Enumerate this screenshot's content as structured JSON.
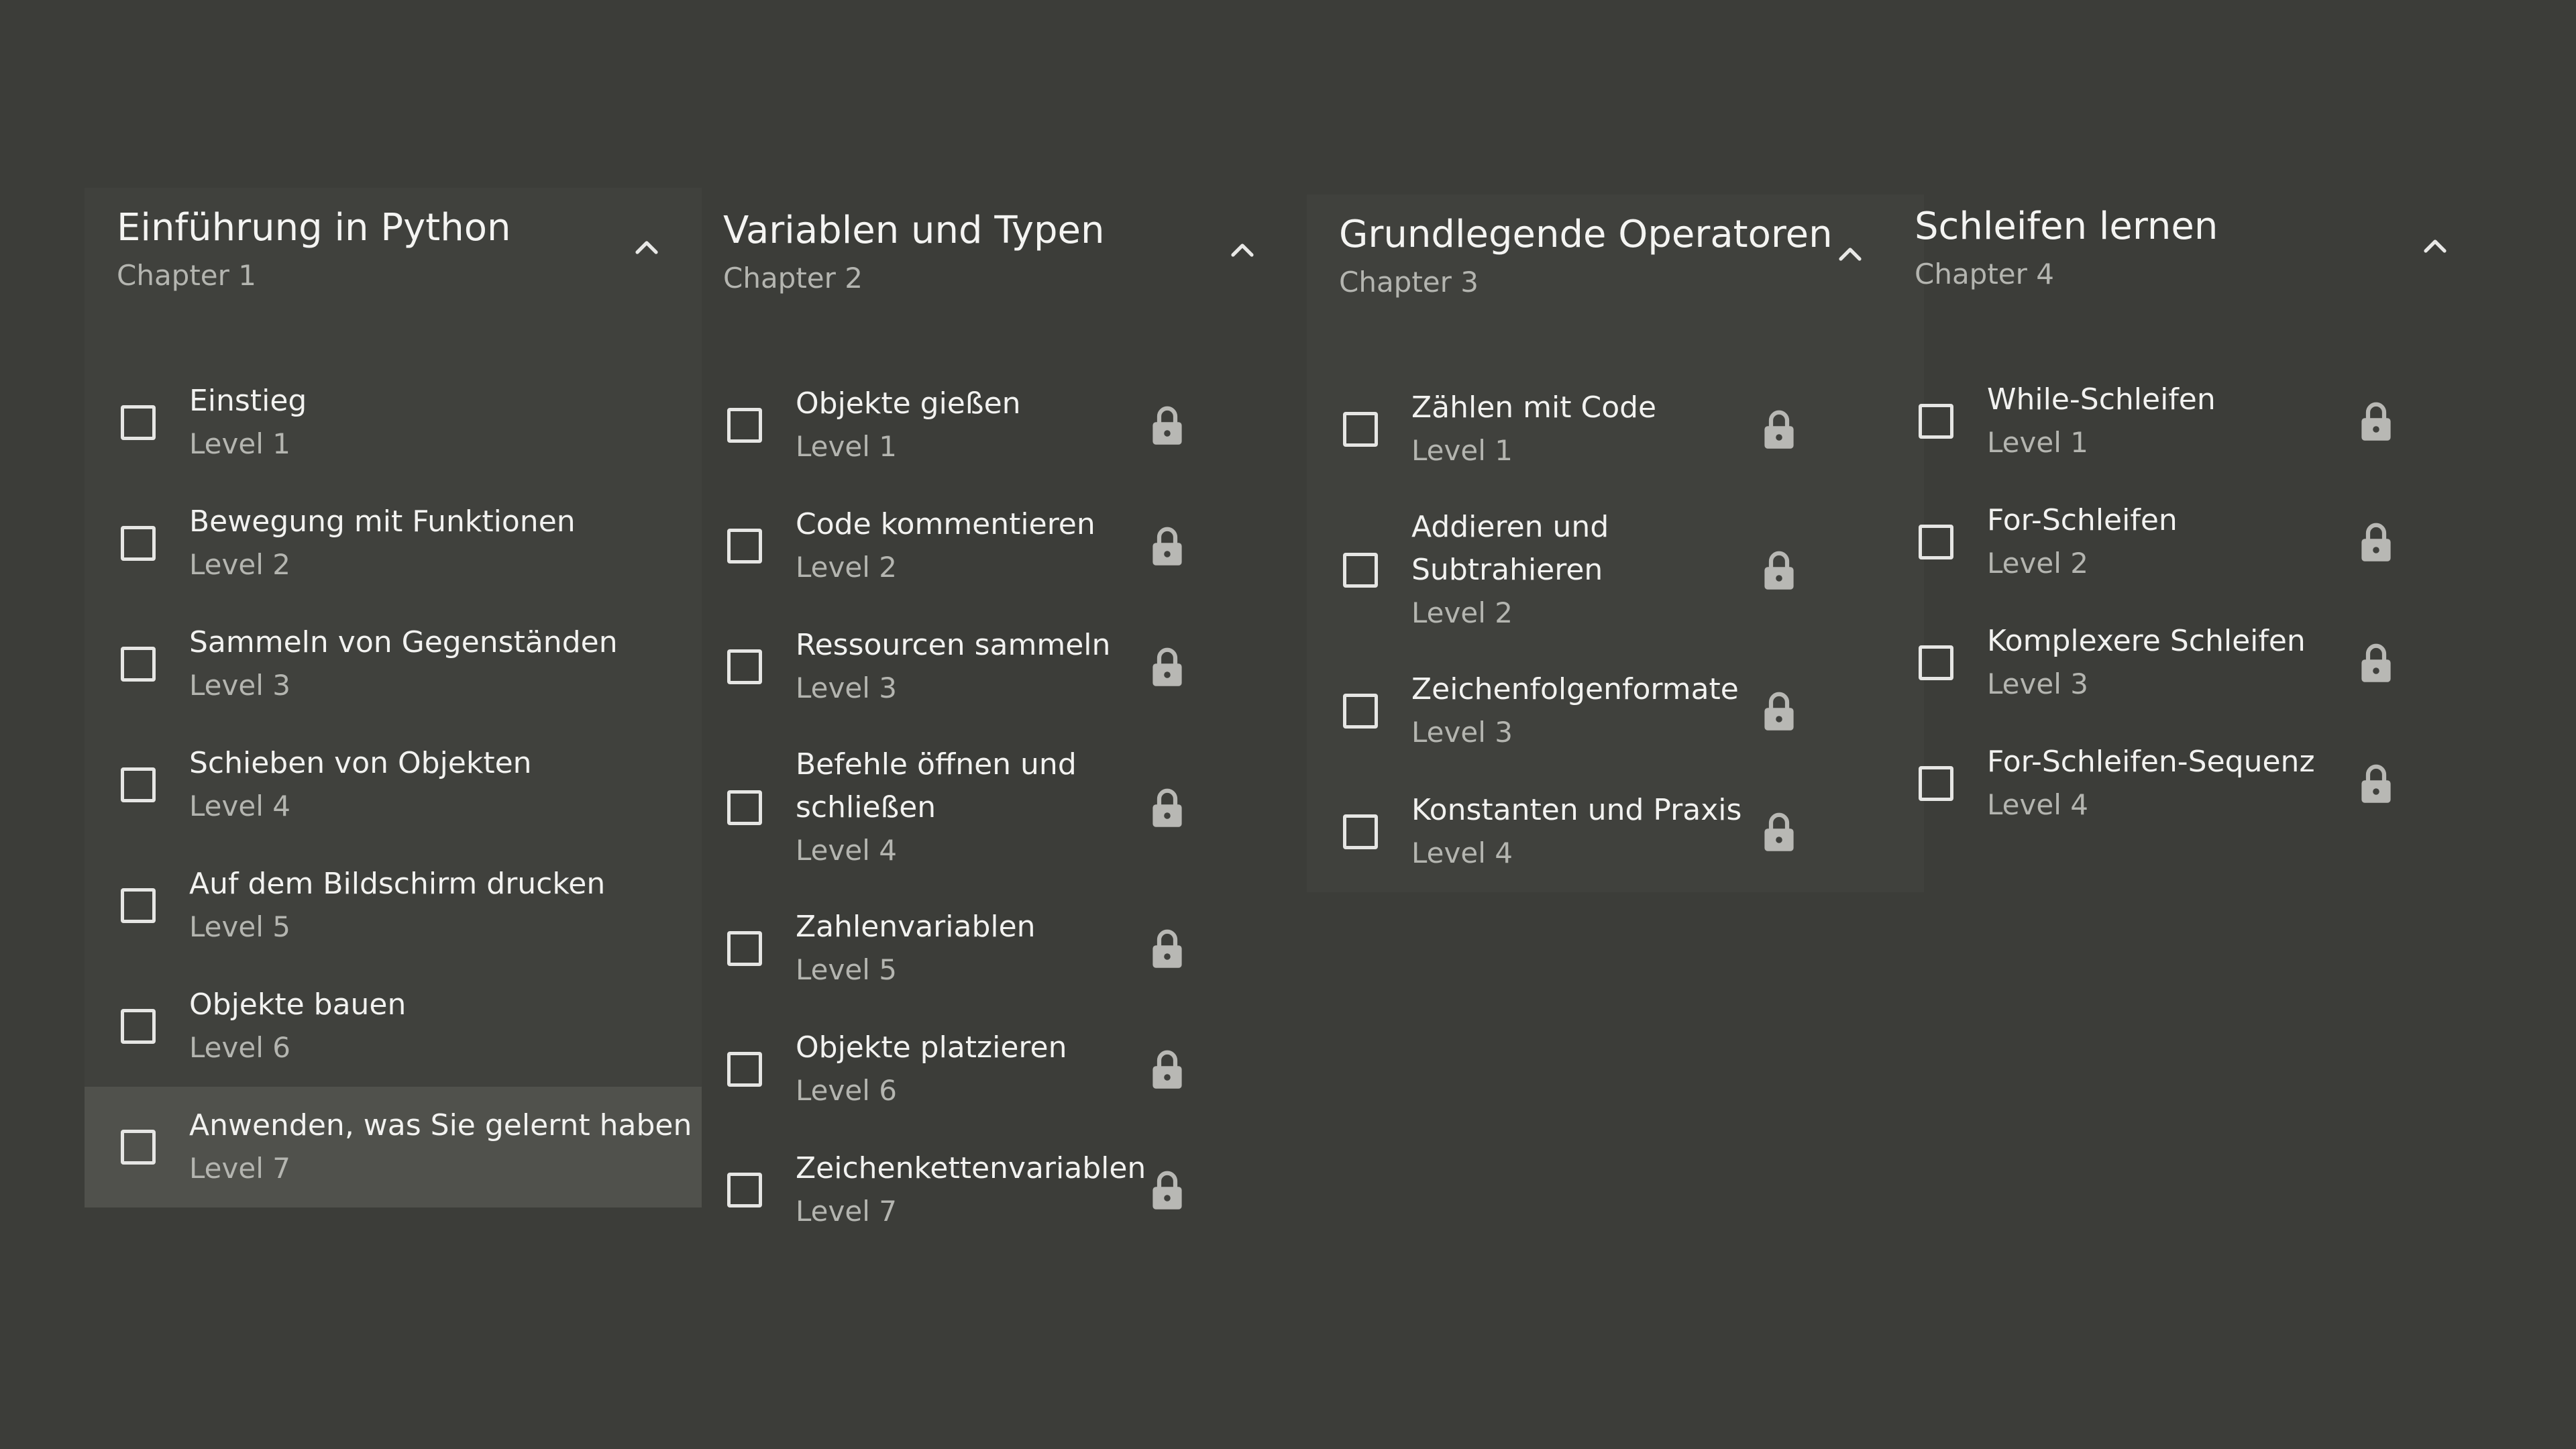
{
  "chapters": [
    {
      "title": "Einführung in Python",
      "subtitle": "Chapter 1",
      "lessons": [
        {
          "name": "Einstieg",
          "level": "Level 1",
          "locked": false
        },
        {
          "name": "Bewegung mit Funktionen",
          "level": "Level 2",
          "locked": false
        },
        {
          "name": "Sammeln von Gegenständen",
          "level": "Level 3",
          "locked": false
        },
        {
          "name": "Schieben von Objekten",
          "level": "Level 4",
          "locked": false
        },
        {
          "name": "Auf dem Bildschirm drucken",
          "level": "Level 5",
          "locked": false
        },
        {
          "name": "Objekte bauen",
          "level": "Level 6",
          "locked": false
        },
        {
          "name": "Anwenden, was Sie gelernt haben",
          "level": "Level 7",
          "locked": false,
          "selected": true
        }
      ]
    },
    {
      "title": "Variablen und Typen",
      "subtitle": "Chapter 2",
      "lessons": [
        {
          "name": "Objekte gießen",
          "level": "Level 1",
          "locked": true
        },
        {
          "name": "Code kommentieren",
          "level": "Level 2",
          "locked": true
        },
        {
          "name": "Ressourcen sammeln",
          "level": "Level 3",
          "locked": true
        },
        {
          "name": "Befehle öffnen und schließen",
          "level": "Level 4",
          "locked": true
        },
        {
          "name": "Zahlenvariablen",
          "level": "Level 5",
          "locked": true
        },
        {
          "name": "Objekte platzieren",
          "level": "Level 6",
          "locked": true
        },
        {
          "name": "Zeichenkettenvariablen",
          "level": "Level 7",
          "locked": true
        }
      ]
    },
    {
      "title": "Grundlegende Operatoren",
      "subtitle": "Chapter 3",
      "lessons": [
        {
          "name": "Zählen mit Code",
          "level": "Level 1",
          "locked": true
        },
        {
          "name": "Addieren und Subtrahieren",
          "level": "Level 2",
          "locked": true
        },
        {
          "name": "Zeichenfolgenformate",
          "level": "Level 3",
          "locked": true
        },
        {
          "name": "Konstanten und Praxis",
          "level": "Level 4",
          "locked": true
        }
      ]
    },
    {
      "title": "Schleifen lernen",
      "subtitle": "Chapter 4",
      "lessons": [
        {
          "name": "While-Schleifen",
          "level": "Level 1",
          "locked": true
        },
        {
          "name": "For-Schleifen",
          "level": "Level 2",
          "locked": true
        },
        {
          "name": "Komplexere Schleifen",
          "level": "Level 3",
          "locked": true
        },
        {
          "name": "For-Schleifen-Sequenz",
          "level": "Level 4",
          "locked": true
        }
      ]
    }
  ],
  "colors": {
    "background": "#3c3d39",
    "panel": "#40413d",
    "selected_row": "#50514c",
    "text": "#f2f2f0",
    "muted_text": "#b4b5b0",
    "lock": "#b8b8b4"
  },
  "icons": {
    "collapse": "chevron-up-icon",
    "checkbox": "checkbox-unchecked-icon",
    "lock": "lock-icon"
  }
}
